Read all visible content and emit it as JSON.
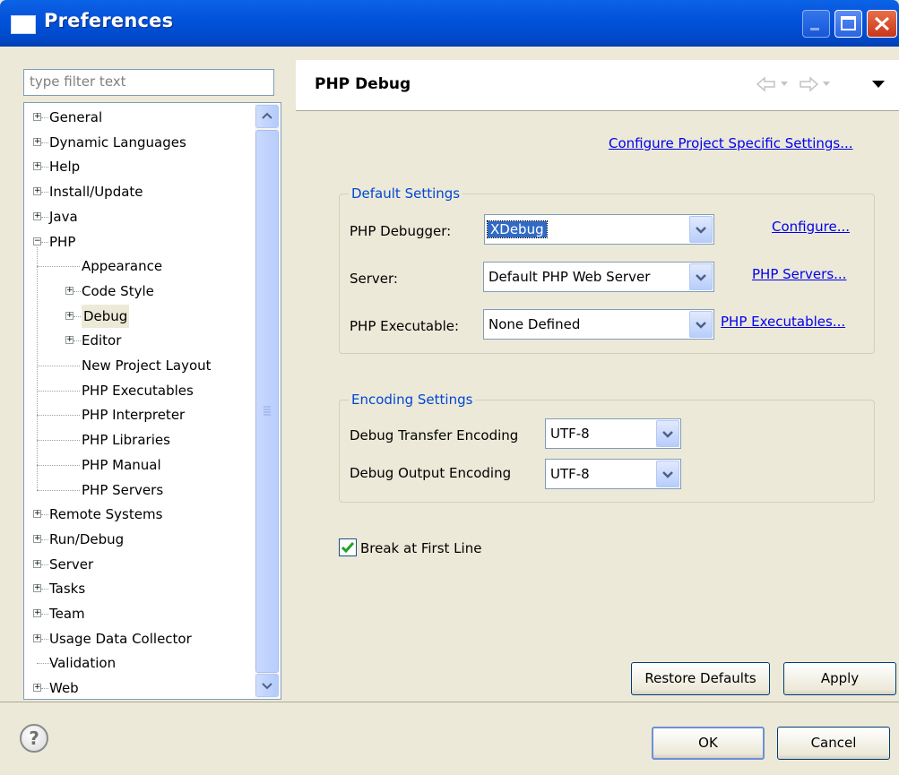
{
  "window": {
    "title": "Preferences"
  },
  "filter": {
    "placeholder": "type filter text"
  },
  "tree": {
    "items": [
      {
        "label": "General",
        "level": 0,
        "expander": "+"
      },
      {
        "label": "Dynamic Languages",
        "level": 0,
        "expander": "+"
      },
      {
        "label": "Help",
        "level": 0,
        "expander": "+"
      },
      {
        "label": "Install/Update",
        "level": 0,
        "expander": "+"
      },
      {
        "label": "Java",
        "level": 0,
        "expander": "+"
      },
      {
        "label": "PHP",
        "level": 0,
        "expander": "-"
      },
      {
        "label": "Appearance",
        "level": 1,
        "expander": ""
      },
      {
        "label": "Code Style",
        "level": 1,
        "expander": "+"
      },
      {
        "label": "Debug",
        "level": 1,
        "expander": "+",
        "selected": true
      },
      {
        "label": "Editor",
        "level": 1,
        "expander": "+"
      },
      {
        "label": "New Project Layout",
        "level": 1,
        "expander": ""
      },
      {
        "label": "PHP Executables",
        "level": 1,
        "expander": ""
      },
      {
        "label": "PHP Interpreter",
        "level": 1,
        "expander": ""
      },
      {
        "label": "PHP Libraries",
        "level": 1,
        "expander": ""
      },
      {
        "label": "PHP Manual",
        "level": 1,
        "expander": ""
      },
      {
        "label": "PHP Servers",
        "level": 1,
        "expander": ""
      },
      {
        "label": "Remote Systems",
        "level": 0,
        "expander": "+"
      },
      {
        "label": "Run/Debug",
        "level": 0,
        "expander": "+"
      },
      {
        "label": "Server",
        "level": 0,
        "expander": "+"
      },
      {
        "label": "Tasks",
        "level": 0,
        "expander": "+"
      },
      {
        "label": "Team",
        "level": 0,
        "expander": "+"
      },
      {
        "label": "Usage Data Collector",
        "level": 0,
        "expander": "+"
      },
      {
        "label": "Validation",
        "level": 0,
        "expander": ""
      },
      {
        "label": "Web",
        "level": 0,
        "expander": "+"
      }
    ]
  },
  "page": {
    "title": "PHP Debug",
    "configure_project_link": "Configure Project Specific Settings...",
    "default_settings": {
      "legend": "Default Settings",
      "debugger_label": "PHP Debugger:",
      "debugger_value": "XDebug",
      "configure_link": "Configure...",
      "server_label": "Server:",
      "server_value": "Default PHP Web Server",
      "servers_link": "PHP Servers...",
      "executable_label": "PHP Executable:",
      "executable_value": "None Defined",
      "executables_link": "PHP Executables..."
    },
    "encoding_settings": {
      "legend": "Encoding Settings",
      "transfer_label": "Debug Transfer Encoding",
      "transfer_value": "UTF-8",
      "output_label": "Debug Output Encoding",
      "output_value": "UTF-8"
    },
    "break_first_line": {
      "label": "Break at First Line",
      "checked": true
    },
    "restore_defaults_label": "Restore Defaults",
    "apply_label": "Apply"
  },
  "footer": {
    "ok_label": "OK",
    "cancel_label": "Cancel"
  },
  "icons": {
    "help": "help-icon",
    "back": "back-arrow-icon",
    "forward": "forward-arrow-icon",
    "menu": "view-menu-icon"
  },
  "colors": {
    "title_bar": "#0a5ae0",
    "link": "#0000ee",
    "legend": "#0046d5",
    "selection": "#316ac5"
  }
}
